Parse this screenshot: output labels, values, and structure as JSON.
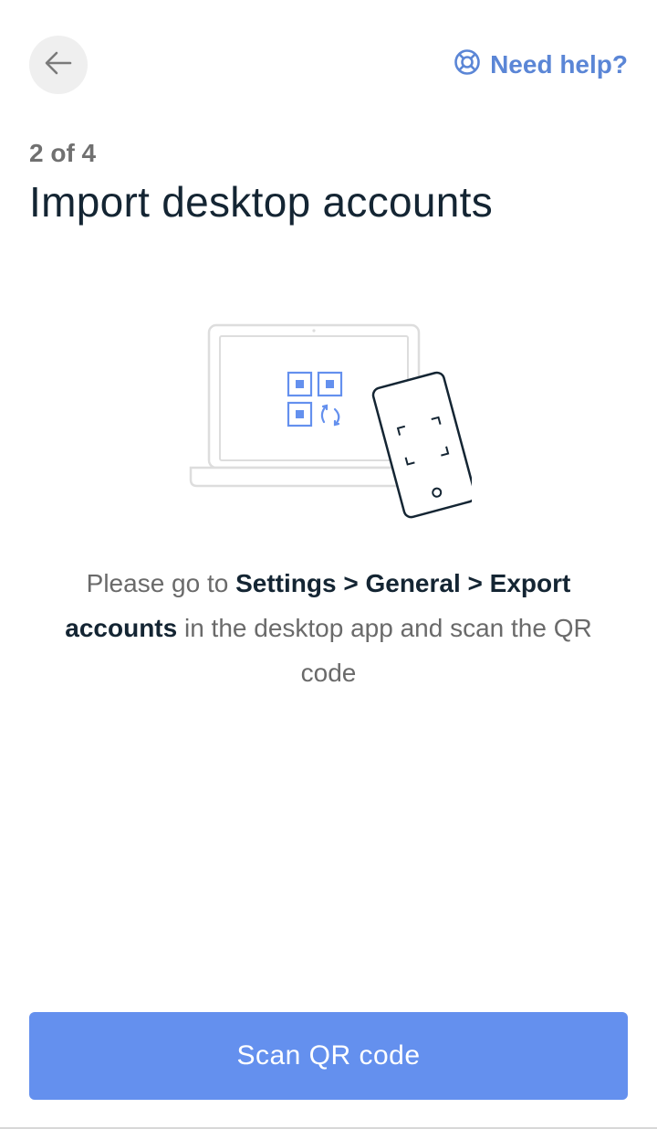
{
  "header": {
    "back_icon": "arrow-left-icon",
    "help_icon": "lifebuoy-icon",
    "help_label": "Need help?"
  },
  "step": {
    "label": "2 of 4"
  },
  "page": {
    "title": "Import desktop accounts"
  },
  "illustration": {
    "icon": "laptop-qr-phone-scan-illustration"
  },
  "instructions": {
    "part1": "Please go to ",
    "bold1": "Settings > General > Export accounts",
    "part2": " in the desktop app and scan the QR code"
  },
  "actions": {
    "scan_label": "Scan QR code"
  },
  "colors": {
    "accent": "#6490ee",
    "link": "#5b86d6",
    "title": "#142533",
    "muted": "#707070"
  }
}
